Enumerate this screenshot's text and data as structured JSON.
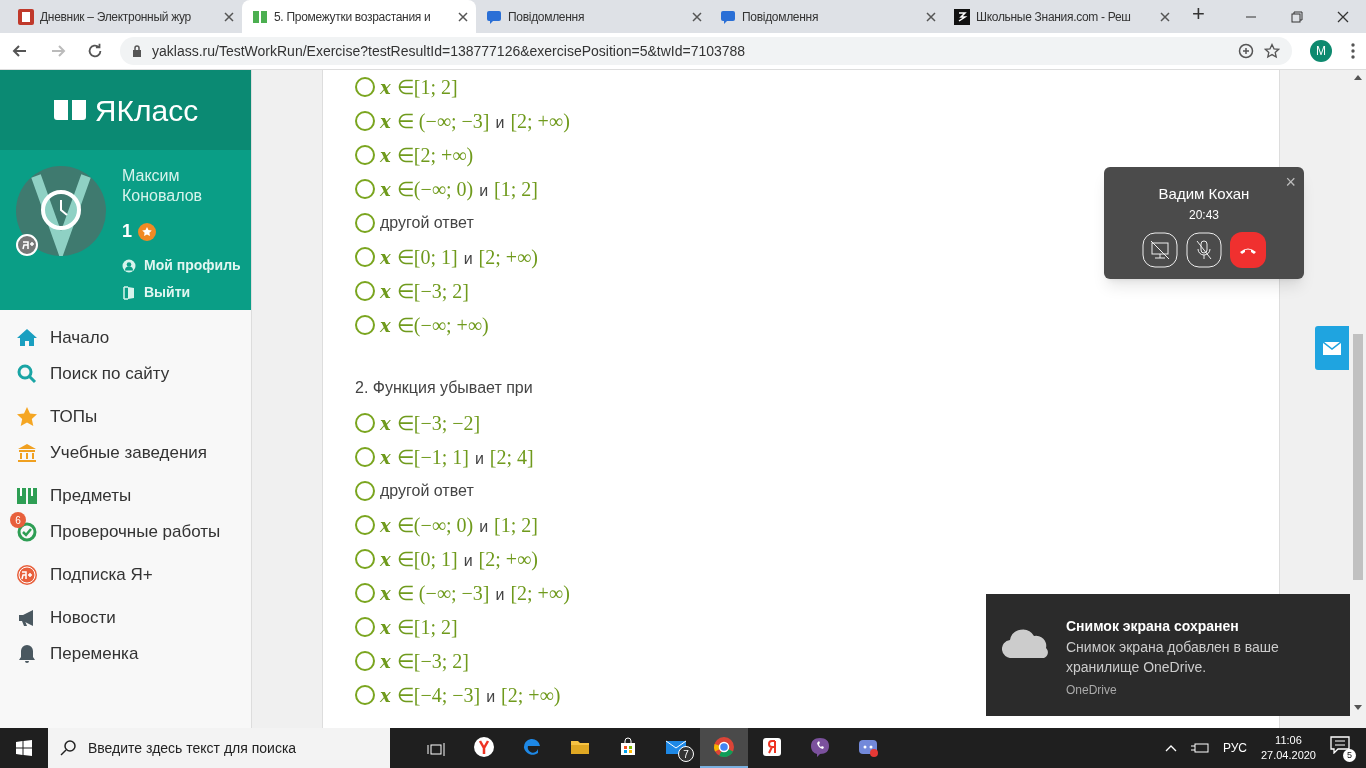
{
  "browser": {
    "tabs": [
      {
        "title": "Дневник – Электронный жур",
        "selected": false
      },
      {
        "title": "5. Промежутки возрастания и",
        "selected": true
      },
      {
        "title": "Повідомлення",
        "selected": false
      },
      {
        "title": "Повідомлення",
        "selected": false
      },
      {
        "title": "Школьные Знания.com - Реш",
        "selected": false
      }
    ],
    "new_tab": "+",
    "url": "yaklass.ru/TestWorkRun/Exercise?testResultId=138777126&exercisePosition=5&twId=7103788",
    "profile": "M"
  },
  "sidebar": {
    "logo": "ЯКласс",
    "user": {
      "first_name": "Максим",
      "last_name": "Коновалов",
      "points": "1",
      "profile_link": "Мой профиль",
      "logout_link": "Выйти"
    },
    "groups": [
      [
        {
          "label": "Начало"
        },
        {
          "label": "Поиск по сайту"
        }
      ],
      [
        {
          "label": "ТОПы"
        },
        {
          "label": "Учебные заведения"
        }
      ],
      [
        {
          "label": "Предметы"
        },
        {
          "label": "Проверочные работы",
          "badge": "6"
        }
      ],
      [
        {
          "label": "Подписка Я+"
        }
      ],
      [
        {
          "label": "Новости"
        },
        {
          "label": "Переменка"
        }
      ]
    ]
  },
  "questions": [
    {
      "options": [
        {
          "selected": false,
          "parts": [
            {
              "kind": "var",
              "text": "x"
            },
            {
              "kind": "math",
              "text": "∈[1; 2]"
            }
          ]
        },
        {
          "selected": false,
          "parts": [
            {
              "kind": "var",
              "text": "x"
            },
            {
              "kind": "math",
              "text": "∈ (−∞; −3]"
            },
            {
              "kind": "word",
              "text": "и"
            },
            {
              "kind": "math",
              "text": "[2; +∞)"
            }
          ]
        },
        {
          "selected": false,
          "parts": [
            {
              "kind": "var",
              "text": "x"
            },
            {
              "kind": "math",
              "text": "∈[2; +∞)"
            }
          ]
        },
        {
          "selected": false,
          "parts": [
            {
              "kind": "var",
              "text": "x"
            },
            {
              "kind": "math",
              "text": "∈(−∞; 0)"
            },
            {
              "kind": "word",
              "text": "и"
            },
            {
              "kind": "math",
              "text": "[1; 2]"
            }
          ]
        },
        {
          "selected": false,
          "parts": [
            {
              "kind": "word",
              "text": "другой ответ"
            }
          ]
        },
        {
          "selected": false,
          "parts": [
            {
              "kind": "var",
              "text": "x"
            },
            {
              "kind": "math",
              "text": "∈[0; 1]"
            },
            {
              "kind": "word",
              "text": "и"
            },
            {
              "kind": "math",
              "text": "[2; +∞)"
            }
          ]
        },
        {
          "selected": false,
          "parts": [
            {
              "kind": "var",
              "text": "x"
            },
            {
              "kind": "math",
              "text": "∈[−3; 2]"
            }
          ]
        },
        {
          "selected": false,
          "parts": [
            {
              "kind": "var",
              "text": "x"
            },
            {
              "kind": "math",
              "text": "∈(−∞; +∞)"
            }
          ]
        }
      ]
    },
    {
      "title": "2. Функция убывает при",
      "options": [
        {
          "selected": false,
          "parts": [
            {
              "kind": "var",
              "text": "x"
            },
            {
              "kind": "math",
              "text": "∈[−3; −2]"
            }
          ]
        },
        {
          "selected": false,
          "parts": [
            {
              "kind": "var",
              "text": "x"
            },
            {
              "kind": "math",
              "text": "∈[−1; 1]"
            },
            {
              "kind": "word",
              "text": "и"
            },
            {
              "kind": "math",
              "text": "[2; 4]"
            }
          ]
        },
        {
          "selected": false,
          "parts": [
            {
              "kind": "word",
              "text": "другой ответ"
            }
          ]
        },
        {
          "selected": false,
          "parts": [
            {
              "kind": "var",
              "text": "x"
            },
            {
              "kind": "math",
              "text": "∈(−∞; 0)"
            },
            {
              "kind": "word",
              "text": "и"
            },
            {
              "kind": "math",
              "text": "[1; 2]"
            }
          ]
        },
        {
          "selected": false,
          "parts": [
            {
              "kind": "var",
              "text": "x"
            },
            {
              "kind": "math",
              "text": "∈[0; 1]"
            },
            {
              "kind": "word",
              "text": "и"
            },
            {
              "kind": "math",
              "text": "[2; +∞)"
            }
          ]
        },
        {
          "selected": false,
          "parts": [
            {
              "kind": "var",
              "text": "x"
            },
            {
              "kind": "math",
              "text": "∈ (−∞; −3]"
            },
            {
              "kind": "word",
              "text": "и"
            },
            {
              "kind": "math",
              "text": "[2; +∞)"
            }
          ]
        },
        {
          "selected": false,
          "parts": [
            {
              "kind": "var",
              "text": "x"
            },
            {
              "kind": "math",
              "text": "∈[1; 2]"
            }
          ]
        },
        {
          "selected": false,
          "parts": [
            {
              "kind": "var",
              "text": "x"
            },
            {
              "kind": "math",
              "text": "∈[−3; 2]"
            }
          ]
        },
        {
          "selected": false,
          "parts": [
            {
              "kind": "var",
              "text": "x"
            },
            {
              "kind": "math",
              "text": "∈[−4; −3]"
            },
            {
              "kind": "word",
              "text": "и"
            },
            {
              "kind": "math",
              "text": "[2; +∞)"
            }
          ]
        }
      ]
    }
  ],
  "call": {
    "name": "Вадим Кохан",
    "duration": "20:43",
    "close": "×"
  },
  "notification": {
    "title": "Снимок экрана сохранен",
    "body": "Снимок экрана добавлен в ваше хранилище OneDrive.",
    "source": "OneDrive"
  },
  "taskbar": {
    "search_placeholder": "Введите здесь текст для поиска",
    "apps": [
      {
        "selected": false
      },
      {
        "selected": false
      },
      {
        "selected": false
      },
      {
        "selected": false
      },
      {
        "selected": false,
        "badge": "7"
      },
      {
        "selected": true
      },
      {
        "selected": false
      },
      {
        "selected": false
      },
      {
        "selected": false
      }
    ],
    "language": "РУС",
    "time": "11:06",
    "date": "27.04.2020",
    "notifications": "5"
  }
}
